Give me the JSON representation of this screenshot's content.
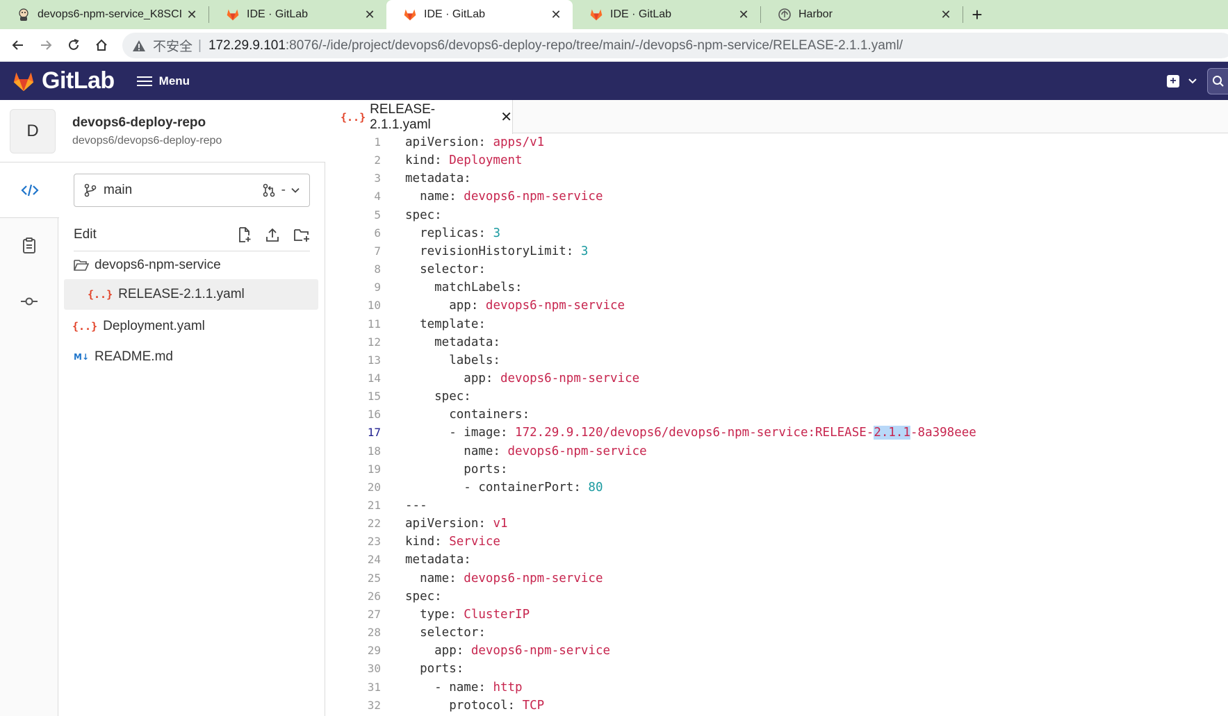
{
  "browser": {
    "tabs": [
      {
        "label": "devops6-npm-service_K8SCI [",
        "icon": "jenkins-icon",
        "active": false
      },
      {
        "label": "IDE · GitLab",
        "icon": "gitlab-icon",
        "active": false
      },
      {
        "label": "IDE · GitLab",
        "icon": "gitlab-icon",
        "active": true
      },
      {
        "label": "IDE · GitLab",
        "icon": "gitlab-icon",
        "active": false
      },
      {
        "label": "Harbor",
        "icon": "harbor-icon",
        "active": false
      }
    ],
    "insecure_label": "不安全",
    "url_host": "172.29.9.101",
    "url_path": ":8076/-/ide/project/devops6/devops6-deploy-repo/tree/main/-/devops6-npm-service/RELEASE-2.1.1.yaml/"
  },
  "gitlab": {
    "wordmark": "GitLab",
    "menu_label": "Menu"
  },
  "project": {
    "avatar_letter": "D",
    "name": "devops6-deploy-repo",
    "path": "devops6/devops6-deploy-repo"
  },
  "filetree": {
    "branch": "main",
    "mr_label": "-",
    "edit_label": "Edit",
    "items": [
      {
        "name": "devops6-npm-service",
        "type": "folder"
      },
      {
        "name": "RELEASE-2.1.1.yaml",
        "type": "yaml",
        "selected": true
      },
      {
        "name": "Deployment.yaml",
        "type": "yaml"
      },
      {
        "name": "README.md",
        "type": "markdown"
      }
    ]
  },
  "editor": {
    "tab_label": "RELEASE-2.1.1.yaml",
    "current_line": 17,
    "lines": [
      [
        [
          "k",
          "apiVersion: "
        ],
        [
          "v",
          "apps/v1"
        ]
      ],
      [
        [
          "k",
          "kind: "
        ],
        [
          "v",
          "Deployment"
        ]
      ],
      [
        [
          "k",
          "metadata:"
        ]
      ],
      [
        [
          "k",
          "  name: "
        ],
        [
          "v",
          "devops6-npm-service"
        ]
      ],
      [
        [
          "k",
          "spec:"
        ]
      ],
      [
        [
          "k",
          "  replicas: "
        ],
        [
          "n",
          "3"
        ]
      ],
      [
        [
          "k",
          "  revisionHistoryLimit: "
        ],
        [
          "n",
          "3"
        ]
      ],
      [
        [
          "k",
          "  selector:"
        ]
      ],
      [
        [
          "k",
          "    matchLabels:"
        ]
      ],
      [
        [
          "k",
          "      app: "
        ],
        [
          "v",
          "devops6-npm-service"
        ]
      ],
      [
        [
          "k",
          "  template:"
        ]
      ],
      [
        [
          "k",
          "    metadata:"
        ]
      ],
      [
        [
          "k",
          "      labels:"
        ]
      ],
      [
        [
          "k",
          "        app: "
        ],
        [
          "v",
          "devops6-npm-service"
        ]
      ],
      [
        [
          "k",
          "    spec:"
        ]
      ],
      [
        [
          "k",
          "      containers:"
        ]
      ],
      [
        [
          "k",
          "      - image: "
        ],
        [
          "v",
          "172.29.9.120/devops6/devops6-npm-service:RELEASE-"
        ],
        [
          "hl",
          "2.1.1"
        ],
        [
          "v",
          "-8a398eee"
        ]
      ],
      [
        [
          "k",
          "        name: "
        ],
        [
          "v",
          "devops6-npm-service"
        ]
      ],
      [
        [
          "k",
          "        ports:"
        ]
      ],
      [
        [
          "k",
          "        - containerPort: "
        ],
        [
          "n",
          "80"
        ]
      ],
      [
        [
          "k",
          "---"
        ]
      ],
      [
        [
          "k",
          "apiVersion: "
        ],
        [
          "v",
          "v1"
        ]
      ],
      [
        [
          "k",
          "kind: "
        ],
        [
          "v",
          "Service"
        ]
      ],
      [
        [
          "k",
          "metadata:"
        ]
      ],
      [
        [
          "k",
          "  name: "
        ],
        [
          "v",
          "devops6-npm-service"
        ]
      ],
      [
        [
          "k",
          "spec:"
        ]
      ],
      [
        [
          "k",
          "  type: "
        ],
        [
          "v",
          "ClusterIP"
        ]
      ],
      [
        [
          "k",
          "  selector:"
        ]
      ],
      [
        [
          "k",
          "    app: "
        ],
        [
          "v",
          "devops6-npm-service"
        ]
      ],
      [
        [
          "k",
          "  ports:"
        ]
      ],
      [
        [
          "k",
          "    - name: "
        ],
        [
          "v",
          "http"
        ]
      ],
      [
        [
          "k",
          "      protocol: "
        ],
        [
          "v",
          "TCP"
        ]
      ]
    ]
  }
}
